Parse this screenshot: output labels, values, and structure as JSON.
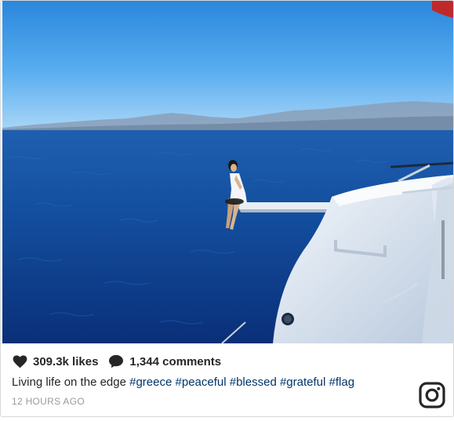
{
  "post": {
    "likes_text": "309.3k likes",
    "comments_text": "1,344 comments",
    "caption_text": "Living life on the edge",
    "hashtags": [
      "#greece",
      "#peaceful",
      "#blessed",
      "#grateful",
      "#flag"
    ],
    "timestamp": "12 HOURS AGO"
  },
  "icons": {
    "like": "heart-icon",
    "comment": "comment-bubble-icon",
    "brand": "instagram-logo-icon"
  },
  "colors": {
    "text": "#262626",
    "hashtag": "#003569",
    "timestamp": "#999999",
    "sky_top": "#2e8fe0",
    "sea": "#0b3c8c"
  }
}
